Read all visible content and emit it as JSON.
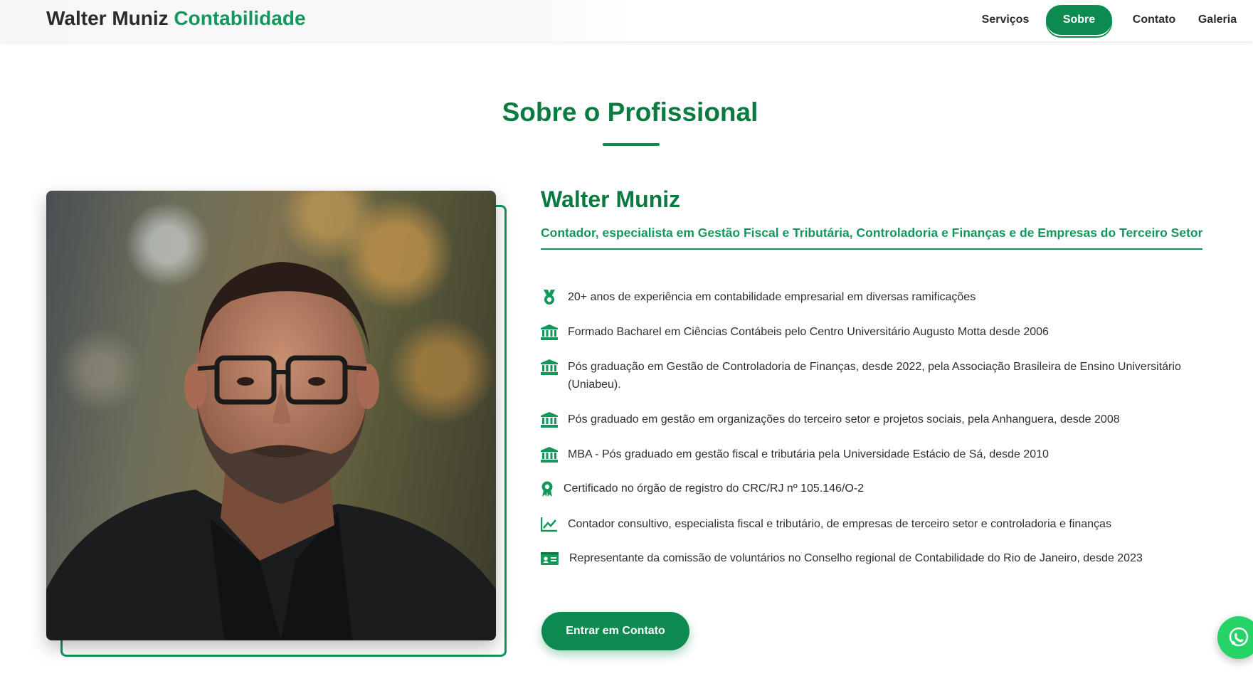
{
  "header": {
    "brand_primary": "Walter Muniz",
    "brand_secondary": "Contabilidade",
    "nav": [
      {
        "label": "Serviços",
        "active": false
      },
      {
        "label": "Sobre",
        "active": true
      },
      {
        "label": "Contato",
        "active": false
      },
      {
        "label": "Galeria",
        "active": false
      }
    ]
  },
  "about": {
    "section_title": "Sobre o Profissional",
    "name": "Walter Muniz",
    "subtitle": "Contador, especialista em Gestão Fiscal e Tributária, Controladoria e Finanças e de Empresas do Terceiro Setor",
    "items": [
      {
        "icon": "medal-icon",
        "text": "20+ anos de experiência em contabilidade empresarial em diversas ramificações"
      },
      {
        "icon": "university-icon",
        "text": "Formado Bacharel em Ciências Contábeis pelo Centro Universitário Augusto Motta desde 2006"
      },
      {
        "icon": "university-icon",
        "text": "Pós graduação em Gestão de Controladoria de Finanças, desde 2022, pela Associação Brasileira de Ensino Universitário (Uniabeu)."
      },
      {
        "icon": "university-icon",
        "text": "Pós graduado em gestão em organizações do terceiro setor e projetos sociais, pela Anhanguera, desde 2008"
      },
      {
        "icon": "university-icon",
        "text": "MBA - Pós graduado em gestão fiscal e tributária pela Universidade Estácio de Sá, desde 2010"
      },
      {
        "icon": "award-icon",
        "text": "Certificado no órgão de registro do CRC/RJ nº 105.146/O-2"
      },
      {
        "icon": "chart-line-icon",
        "text": "Contador consultivo, especialista fiscal e tributário, de empresas de terceiro setor e controladoria e finanças"
      },
      {
        "icon": "id-card-icon",
        "text": "Representante da comissão de voluntários no Conselho regional de Contabilidade do Rio de Janeiro, desde 2023"
      }
    ],
    "cta_label": "Entrar em Contato"
  },
  "floating": {
    "icon": "whatsapp-icon"
  },
  "colors": {
    "primary": "#0c8a4f",
    "heading": "#0b7a40",
    "accent": "#13975a",
    "whatsapp": "#25d366"
  }
}
